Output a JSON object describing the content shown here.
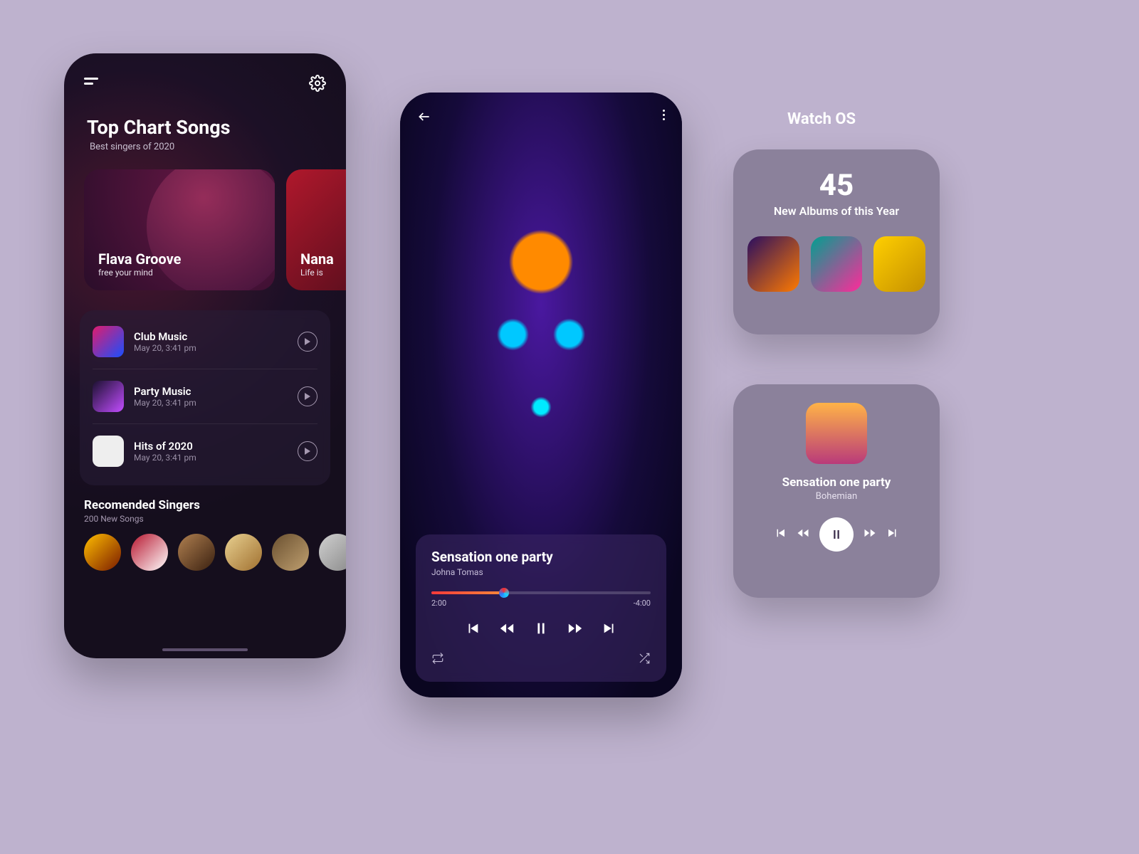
{
  "screen_list": {
    "title": "Top Chart Songs",
    "subtitle": "Best singers of 2020",
    "cards": [
      {
        "title": "Flava Groove",
        "subtitle": "free your mind"
      },
      {
        "title": "Nana",
        "subtitle": "Life is"
      }
    ],
    "songs": [
      {
        "name": "Club Music",
        "date": "May 20, 3:41 pm"
      },
      {
        "name": "Party Music",
        "date": "May 20, 3:41 pm"
      },
      {
        "name": "Hits of 2020",
        "date": "May 20, 3:41 pm"
      }
    ],
    "recommended_title": "Recomended Singers",
    "recommended_sub": "200  New Songs"
  },
  "screen_player": {
    "title": "Sensation one party",
    "artist": "Johna Tomas",
    "elapsed": "2:00",
    "remaining": "-4:00"
  },
  "watch": {
    "label": "Watch OS",
    "albums_count": "45",
    "albums_caption": "New Albums of this Year",
    "now_title": "Sensation one party",
    "now_artist": "Bohemian"
  }
}
